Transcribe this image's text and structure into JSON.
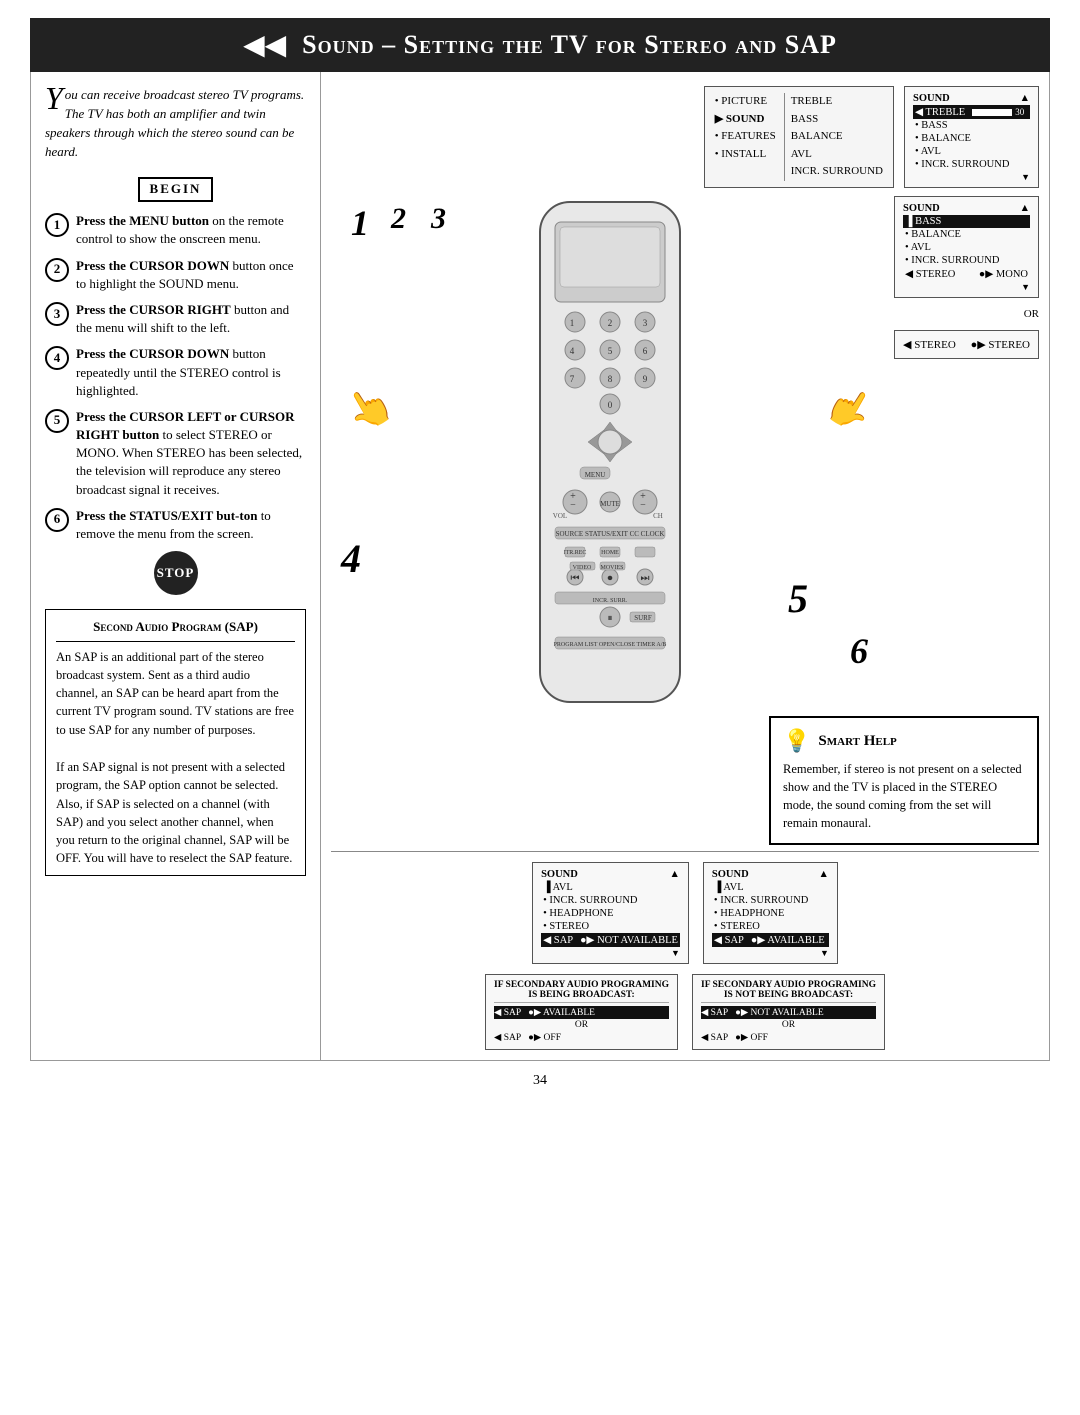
{
  "header": {
    "title": "Sound – Setting the TV for Stereo and SAP",
    "icon": "◀◀"
  },
  "intro": {
    "drop_cap": "Y",
    "text": "ou can receive broadcast stereo TV programs.  The TV has both an amplifier and twin speakers through which the stereo sound can be heard."
  },
  "begin_label": "BEGIN",
  "steps": [
    {
      "num": "1",
      "text_strong": "Press the MENU button",
      "text_rest": " on the remote control to show the onscreen menu."
    },
    {
      "num": "2",
      "text_strong": "Press the CURSOR DOWN",
      "text_rest": " button once to highlight the SOUND menu."
    },
    {
      "num": "3",
      "text_strong": "Press the CURSOR RIGHT",
      "text_rest": " button and the menu will shift to the left."
    },
    {
      "num": "4",
      "text_strong": "Press the CURSOR DOWN",
      "text_rest": " button repeatedly until the STEREO control is highlighted."
    },
    {
      "num": "5",
      "text_strong": "Press the CURSOR LEFT or CURSOR RIGHT button",
      "text_rest": " to select STEREO or MONO.  When STEREO has been selected, the television will reproduce any stereo broadcast signal it receives."
    },
    {
      "num": "6",
      "text_strong": "Press the STATUS/EXIT but-ton",
      "text_rest": " to remove the menu from the screen."
    }
  ],
  "stop_label": "STOP",
  "sap_section": {
    "title": "Second Audio Program (SAP)",
    "paragraphs": [
      "An SAP is an additional part of the stereo broadcast system.  Sent as a third audio channel, an SAP can be heard apart from the current TV program sound.  TV stations are free to use SAP for any number of purposes.",
      "If an SAP signal is not present with a selected program, the SAP option cannot be selected.  Also, if SAP is selected on a channel (with SAP) and you select another channel, when you return to the original channel, SAP will be OFF.  You will have to reselect the SAP feature."
    ]
  },
  "smart_help": {
    "title": "Smart Help",
    "text": "Remember, if stereo is not present on a selected show and the TV is placed in the STEREO mode, the sound coming from the set will remain monaural."
  },
  "osd_screen1": {
    "title": "SOUND",
    "arrow_up": "▲",
    "rows": [
      {
        "label": "TREBLE",
        "value": "30",
        "bar": true,
        "selected": true
      },
      {
        "label": "BASS",
        "selected": false
      },
      {
        "label": "BALANCE",
        "selected": false
      },
      {
        "label": "AVL",
        "selected": false
      },
      {
        "label": "INCR. SURROUND",
        "selected": false
      }
    ],
    "arrow_down": "▼"
  },
  "osd_screen2": {
    "title": "SOUND",
    "arrow_up": "▲",
    "rows": [
      {
        "label": "BASS",
        "selected": true
      },
      {
        "label": "BALANCE",
        "selected": false
      },
      {
        "label": "AVL",
        "selected": false
      },
      {
        "label": "INCR. SURROUND",
        "selected": false
      },
      {
        "label": "STEREO",
        "value": "◀ MONO",
        "selected": false,
        "highlight": true
      }
    ],
    "arrow_down": "▼"
  },
  "osd_screen3": {
    "title": "SOUND",
    "rows": [
      {
        "label": "▶ STEREO",
        "value": "◀ STEREO"
      }
    ]
  },
  "main_menu_screen": {
    "rows": [
      {
        "label": "• PICTURE"
      },
      {
        "label": "▶ SOUND",
        "selected": true
      },
      {
        "label": "• FEATURES"
      },
      {
        "label": "• INSTALL"
      }
    ],
    "right_items": [
      "TREBLE",
      "BASS",
      "BALANCE",
      "AVL",
      "INCR. SURROUND"
    ]
  },
  "sap_screen_not_available": {
    "title": "SOUND",
    "rows": [
      {
        "label": "AVL"
      },
      {
        "label": "INCR. SURROUND"
      },
      {
        "label": "HEADPHONE"
      },
      {
        "label": "STEREO"
      },
      {
        "label": "SAP",
        "value": "● NOT AVAILABLE",
        "selected": true
      }
    ]
  },
  "sap_screen_available": {
    "title": "SOUND",
    "rows": [
      {
        "label": "AVL"
      },
      {
        "label": "INCR. SURROUND"
      },
      {
        "label": "HEADPHONE"
      },
      {
        "label": "STEREO"
      },
      {
        "label": "SAP",
        "value": "● AVAILABLE",
        "selected": true
      }
    ]
  },
  "bottom_label_left": {
    "title": "IF SECONDARY AUDIO PROGRAMING IS BEING BROADCAST:",
    "rows": [
      {
        "label": "◀ SAP",
        "value": "●▶ AVAILABLE"
      },
      {
        "label": "OR"
      },
      {
        "label": "◀ SAP",
        "value": "●▶ OFF"
      }
    ]
  },
  "bottom_label_right": {
    "title": "IF SECONDARY AUDIO PROGRAMING IS NOT BEING BROADCAST:",
    "rows": [
      {
        "label": "◀ SAP",
        "value": "●▶ NOT AVAILABLE"
      },
      {
        "label": "OR"
      },
      {
        "label": "◀ SAP",
        "value": "●▶ OFF"
      }
    ]
  },
  "page_number": "34"
}
